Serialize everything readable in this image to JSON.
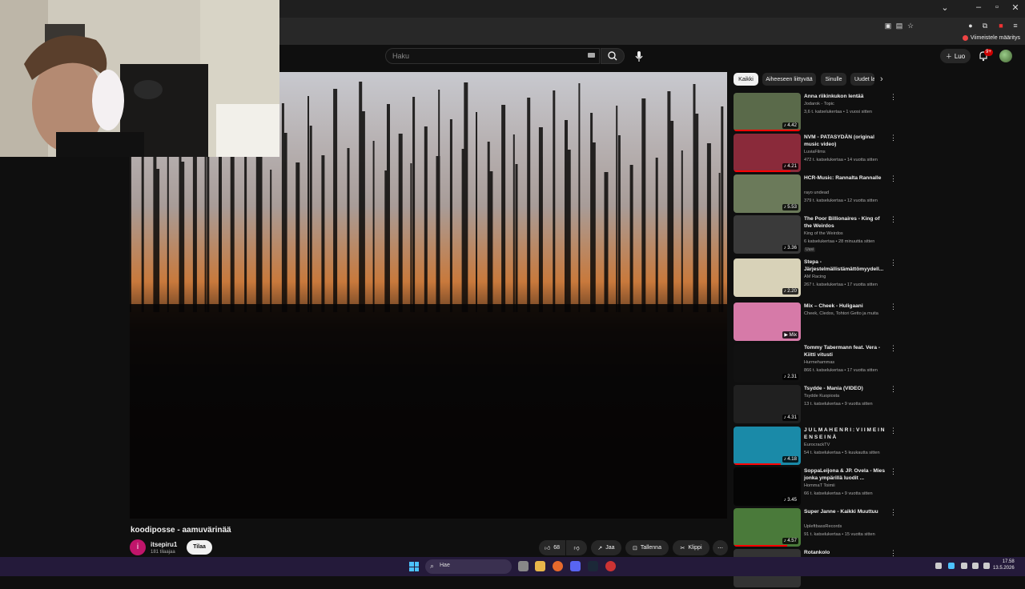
{
  "browser": {
    "bookmark": "Viimeistele määritys"
  },
  "header": {
    "search_placeholder": "Haku",
    "create_label": "Luo",
    "notifications_badge": "9+"
  },
  "video": {
    "title": "koodiposse - aamuvärinää",
    "channel": {
      "avatar_letter": "i",
      "name": "itsepiru1",
      "subscribers": "181 tilaajaa"
    },
    "subscribe_label": "Tilaa",
    "actions": {
      "likes": "68",
      "share": "Jaa",
      "save": "Tallenna",
      "clip": "Klippi"
    }
  },
  "chips": [
    "Kaikki",
    "Aiheeseen liittyvää",
    "Sinulle",
    "Uudet la"
  ],
  "recommendations": [
    {
      "title": "Anna riikinkukon lentää",
      "channel": "Jodarok - Topic",
      "meta": "3,6 t. katselukertaa • 1 vuosi sitten",
      "duration": "♪ 4.42",
      "progress": 1.0
    },
    {
      "title": "NVM - PATASYDÄN (original music video)",
      "channel": "LuviaFilms",
      "meta": "472 t. katselukertaa • 14 vuotta sitten",
      "duration": "♪ 4.21",
      "progress": 0.85
    },
    {
      "title": "HCR-Music: Rannalta Rannalle",
      "channel": "rayo undead",
      "meta": "379 t. katselukertaa • 12 vuotta sitten",
      "duration": "♪ 5.53",
      "progress": 0
    },
    {
      "title": "The Poor Billionaires - King of the Weirdos",
      "channel": "King of the Weirdos",
      "meta": "6 katselukertaa • 28 minuuttia sitten",
      "badge": "Uusi",
      "duration": "♪ 3.36",
      "progress": 0
    },
    {
      "title": "Stepa - Järjestelmällistämättömyydell...",
      "channel": "AM Racing",
      "meta": "267 t. katselukertaa • 17 vuotta sitten",
      "duration": "♪ 2.20",
      "progress": 0
    },
    {
      "title": "Mix – Cheek - Huligaani",
      "channel": "Cheek, Cledos, Tohtori Getto ja muita",
      "meta": "",
      "duration": "▶ Mix",
      "progress": 0
    },
    {
      "title": "Tommy Tabermann feat. Vera - Kiitti vitusti",
      "channel": "Hurmehammas",
      "meta": "866 t. katselukertaa • 17 vuotta sitten",
      "duration": "♪ 2.31",
      "progress": 0
    },
    {
      "title": "Tsydde - Mania (VIDEO)",
      "channel": "Tsydde Kuopiosta",
      "meta": "13 t. katselukertaa • 9 vuotta sitten",
      "duration": "♪ 4.31",
      "progress": 0
    },
    {
      "title": "J U L M A H E N R I : V I I M E I N E N S E I N Ä",
      "channel": "EurocrackTV",
      "meta": "54 t. katselukertaa • 5 kuukautta sitten",
      "duration": "♪ 4.18",
      "progress": 0.7
    },
    {
      "title": "SoppaLeijona & JP. Ovela - Mies jonka ympärillä luodit ...",
      "channel": "HommaT Toimii",
      "meta": "66 t. katselukertaa • 9 vuotta sitten",
      "duration": "♪ 3.45",
      "progress": 0
    },
    {
      "title": "Super Janne - Kaikki Muuttuu",
      "channel": "UpleftbassRecords",
      "meta": "91 t. katselukertaa • 15 vuotta sitten",
      "duration": "♪ 4.57",
      "progress": 0.8
    },
    {
      "title": "Rotankolo",
      "channel": "",
      "meta": "",
      "duration": "",
      "progress": 0
    }
  ],
  "taskbar": {
    "search_label": "Hae",
    "time": "17.58",
    "date": "13.5.2026"
  }
}
